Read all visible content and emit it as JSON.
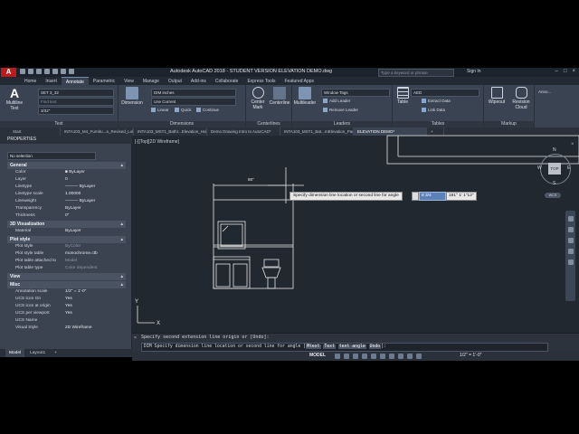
{
  "app": {
    "logo_letter": "A",
    "window_title": "Autodesk AutoCAD 2018 - STUDENT VERSION   ELEVATION DEMO.dwg",
    "search_placeholder": "Type a keyword or phrase",
    "sign_in": "Sign In",
    "window_controls": [
      "–",
      "□",
      "×"
    ]
  },
  "ribbon_tabs": [
    "Home",
    "Insert",
    "Annotate",
    "Parametric",
    "View",
    "Manage",
    "Output",
    "Add-ins",
    "Collaborate",
    "Express Tools",
    "Featured Apps"
  ],
  "active_ribbon_tab": "Annotate",
  "ribbon": {
    "text_panel": {
      "title": "Text",
      "multiline_label": "Multiline\nText",
      "text_style": "SET 3_32",
      "find_placeholder": "Find text",
      "text_height": "3/32\""
    },
    "dimensions_panel": {
      "title": "Dimensions",
      "dimension_label": "Dimension",
      "dim_style": "DIM inches",
      "layer": "Use Current",
      "linear": "Linear",
      "quick": "Quick",
      "continue": "Continue"
    },
    "centerlines_panel": {
      "title": "Centerlines",
      "center_mark": "Center\nMark",
      "centerline": "Centerline"
    },
    "leaders_panel": {
      "title": "Leaders",
      "multileader": "Multileader",
      "leader_style": "Window Tags",
      "add_leader": "Add Leader",
      "remove_leader": "Remove Leader"
    },
    "tables_panel": {
      "title": "Tables",
      "table": "Table",
      "table_style": "AED",
      "extract_data": "Extract Data",
      "link_data": "Link Data"
    },
    "markup_panel": {
      "title": "Markup",
      "wipeout": "Wipeout",
      "revision_cloud": "Revision\nCloud"
    },
    "anno_panel": {
      "title": "Anno..."
    }
  },
  "file_tabs": [
    "Start",
    "INTA103_M4_Furnitu...a_Revised_Lok...",
    "INTA103_MST1_Bathr...Elevation_Hollis*",
    "Demo Drawing Intro to AutoCAD*",
    "INTA103_MST1_Bat...mElevation_ParkM*",
    "ELEVATION DEMO*"
  ],
  "active_file_tab": "ELEVATION DEMO*",
  "properties": {
    "header": "PROPERTIES",
    "selection": "No selection",
    "sections": [
      {
        "title": "General",
        "rows": [
          {
            "k": "Color",
            "v": "■ ByLayer"
          },
          {
            "k": "Layer",
            "v": "0"
          },
          {
            "k": "Linetype",
            "v": "——— ByLayer"
          },
          {
            "k": "Linetype scale",
            "v": "1.00000"
          },
          {
            "k": "Lineweight",
            "v": "——— ByLayer"
          },
          {
            "k": "Transparency",
            "v": "ByLayer"
          },
          {
            "k": "Thickness",
            "v": "0\""
          }
        ]
      },
      {
        "title": "3D Visualization",
        "rows": [
          {
            "k": "Material",
            "v": "ByLayer"
          }
        ]
      },
      {
        "title": "Plot style",
        "rows": [
          {
            "k": "Plot style",
            "v": "ByColor",
            "dim": true
          },
          {
            "k": "Plot style table",
            "v": "monochrome.ctb"
          },
          {
            "k": "Plot table attached to",
            "v": "Model",
            "dim": true
          },
          {
            "k": "Plot table type",
            "v": "Color dependent",
            "dim": true
          }
        ]
      },
      {
        "title": "View",
        "rows": []
      },
      {
        "title": "Misc",
        "rows": [
          {
            "k": "Annotation scale",
            "v": "1/2\" = 1'-0\""
          },
          {
            "k": "UCS icon On",
            "v": "Yes"
          },
          {
            "k": "UCS icon at origin",
            "v": "Yes"
          },
          {
            "k": "UCS per viewport",
            "v": "Yes"
          },
          {
            "k": "UCS Name",
            "v": ""
          },
          {
            "k": "Visual Style",
            "v": "2D Wireframe"
          }
        ]
      }
    ]
  },
  "layout_tabs": [
    "Model",
    "Layout1",
    "+"
  ],
  "viewport_label": "[-][Top][2D Wireframe]",
  "dynamic_input": {
    "prompt": "Specify dimension line location or second line for angle",
    "value1": "8 3/4",
    "value2": "181° 1' 1\"12\""
  },
  "dimension_text": "88\"",
  "command": {
    "history": "Specify second extension line origin or [Undo]:",
    "prompt_prefix": "DIM Specify dimension line location or second line for angle [",
    "options": [
      "Mtext",
      "Text",
      "text angle",
      "Undo"
    ],
    "suffix": "]:"
  },
  "viewcube": {
    "top": "TOP",
    "n": "N",
    "s": "S",
    "e": "E",
    "w": "W",
    "wcs": "WCS"
  },
  "status": {
    "model": "MODEL",
    "scale": "1/2\" = 1'-0\""
  },
  "colors": {
    "drawing_bg": "#212830",
    "geometry": "#e6e6e6",
    "accent": "#5a81b8"
  }
}
